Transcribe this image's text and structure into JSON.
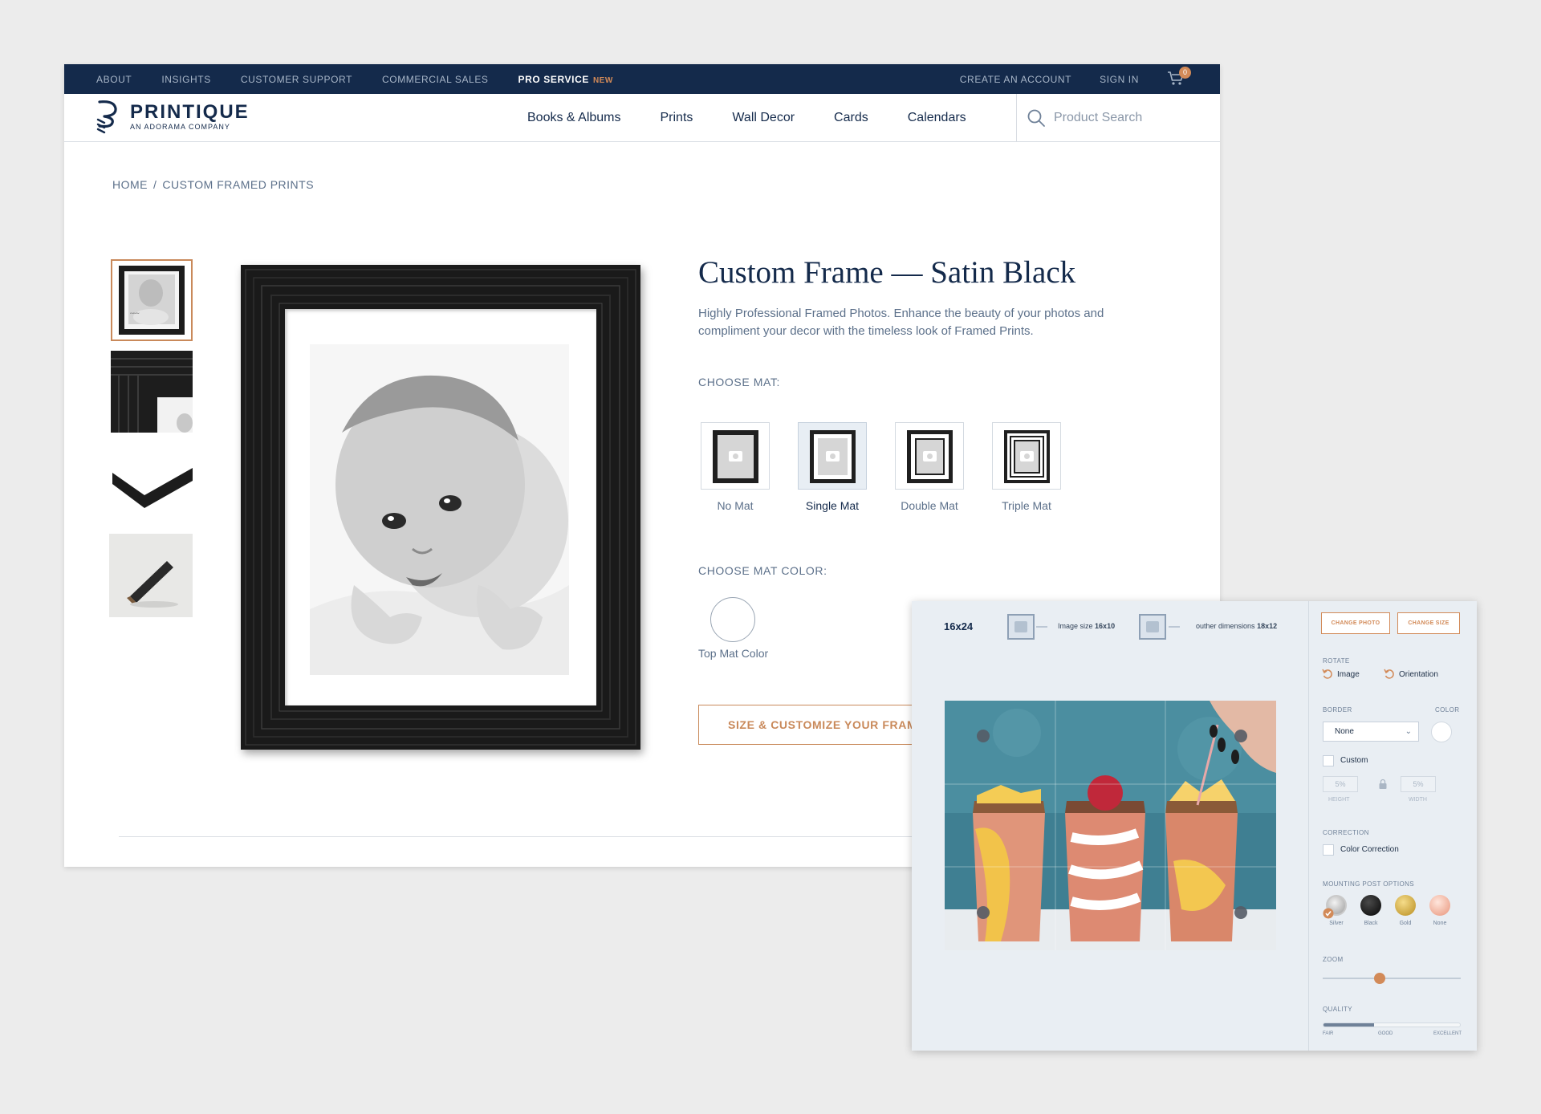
{
  "topbar": {
    "links": [
      "ABOUT",
      "INSIGHTS",
      "CUSTOMER SUPPORT",
      "COMMERCIAL SALES"
    ],
    "pro_service": "PRO SERVICE",
    "new_tag": "NEW",
    "create_account": "CREATE AN ACCOUNT",
    "sign_in": "SIGN IN",
    "cart_count": "0"
  },
  "logo": {
    "name": "PRINTIQUE",
    "sub": "AN ADORAMA COMPANY"
  },
  "nav": {
    "items": [
      "Books & Albums",
      "Prints",
      "Wall Decor",
      "Cards",
      "Calendars"
    ],
    "search_placeholder": "Product Search"
  },
  "breadcrumb": {
    "home": "HOME",
    "separator": "/",
    "current": "CUSTOM FRAMED PRINTS"
  },
  "product": {
    "title": "Custom Frame — Satin Black",
    "description": "Highly Professional Framed Photos. Enhance the beauty of your photos and compliment your decor with the timeless look of Framed Prints.",
    "choose_mat_label": "CHOOSE MAT:",
    "mat_options": [
      "No Mat",
      "Single Mat",
      "Double Mat",
      "Triple Mat"
    ],
    "selected_mat": "Single Mat",
    "choose_mat_color_label": "CHOOSE MAT COLOR:",
    "top_mat_color_label": "Top Mat Color",
    "cta": "SIZE & CUSTOMIZE YOUR FRAME"
  },
  "editor": {
    "size": "16x24",
    "image_size_label": "Image size",
    "image_size_value": "16x10",
    "outer_dims_label": "outher dimensions",
    "outer_dims_value": "18x12",
    "change_photo": "CHANGE PHOTO",
    "change_size": "CHANGE SIZE",
    "rotate_label": "ROTATE",
    "rotate_image": "Image",
    "rotate_orientation": "Orientation",
    "border_label": "BORDER",
    "color_label": "COLOR",
    "border_value": "None",
    "custom_label": "Custom",
    "height_value": "5%",
    "width_value": "5%",
    "height_label": "HEIGHT",
    "width_label": "WIDTH",
    "correction_label": "CORRECTION",
    "color_correction": "Color Correction",
    "mounting_label": "MOUNTING POST OPTIONS",
    "mounting_options": [
      "Silver",
      "Black",
      "Gold",
      "None"
    ],
    "zoom_label": "ZOOM",
    "zoom_level": 0.41,
    "quality_label": "QUALITY",
    "quality_level": 0.37,
    "quality_scale": [
      "FAIR",
      "GOOD",
      "EXCELLENT"
    ]
  },
  "colors": {
    "navy": "#142a4b",
    "accent": "#c9895a",
    "text_muted": "#5c708a",
    "editor_bg": "#e9eef3"
  }
}
